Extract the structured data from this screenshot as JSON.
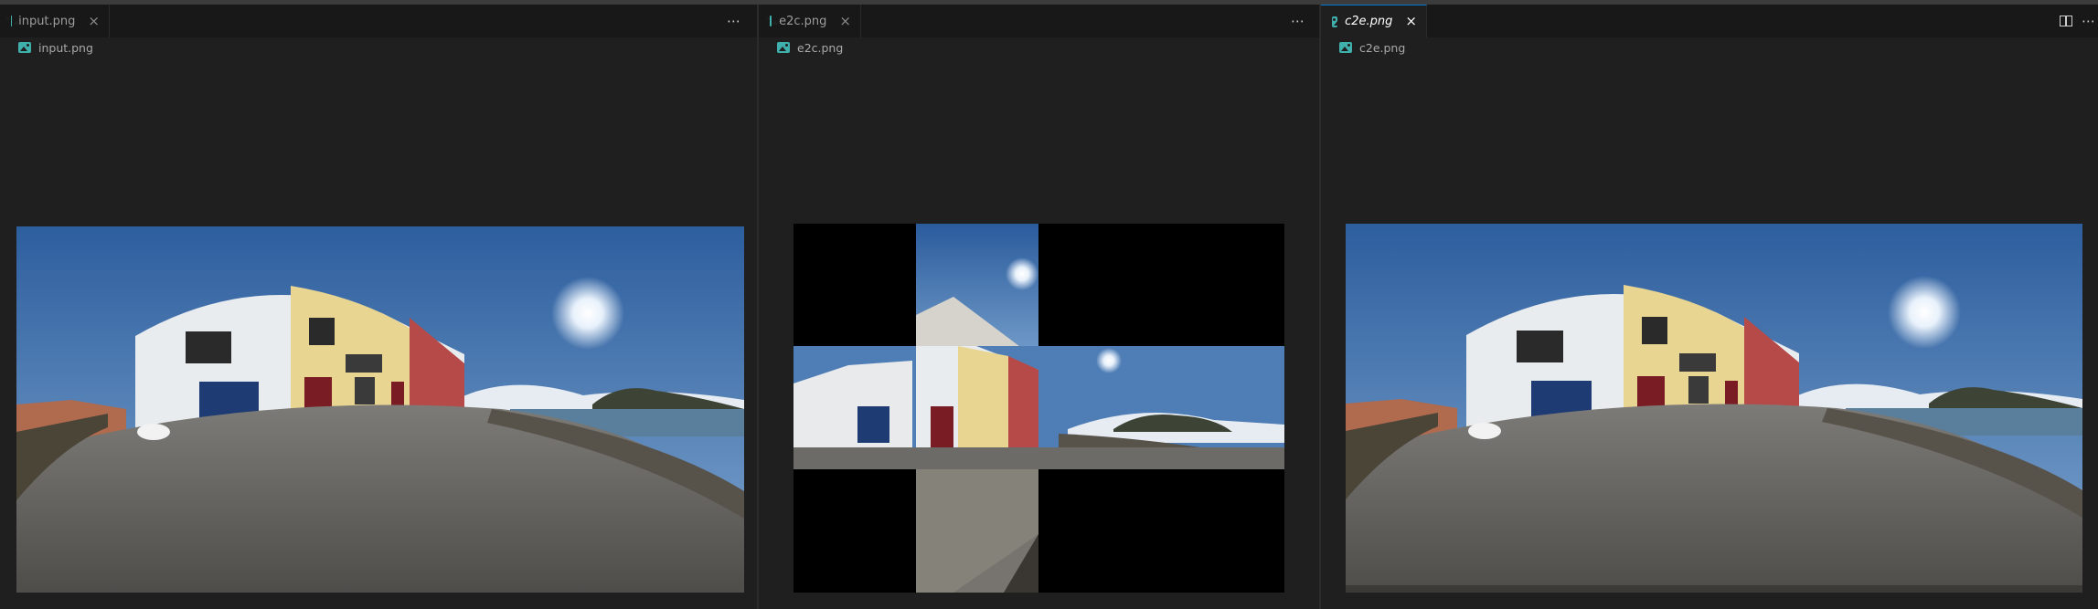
{
  "panes": [
    {
      "tab_label": "input.png",
      "breadcrumb": "input.png",
      "active": false,
      "close_glyph": "×",
      "more_glyph": "⋯",
      "icon": "image-file-icon"
    },
    {
      "tab_label": "e2c.png",
      "breadcrumb": "e2c.png",
      "active": false,
      "close_glyph": "×",
      "more_glyph": "⋯",
      "icon": "image-file-icon"
    },
    {
      "tab_label": "c2e.png",
      "breadcrumb": "c2e.png",
      "active": true,
      "close_glyph": "×",
      "more_glyph": "⋯",
      "icon": "image-file-icon"
    }
  ],
  "colors": {
    "background": "#1f1f1f",
    "tabstrip": "#181818",
    "accent": "#0078d4",
    "file_icon": "#3fb0ac"
  }
}
